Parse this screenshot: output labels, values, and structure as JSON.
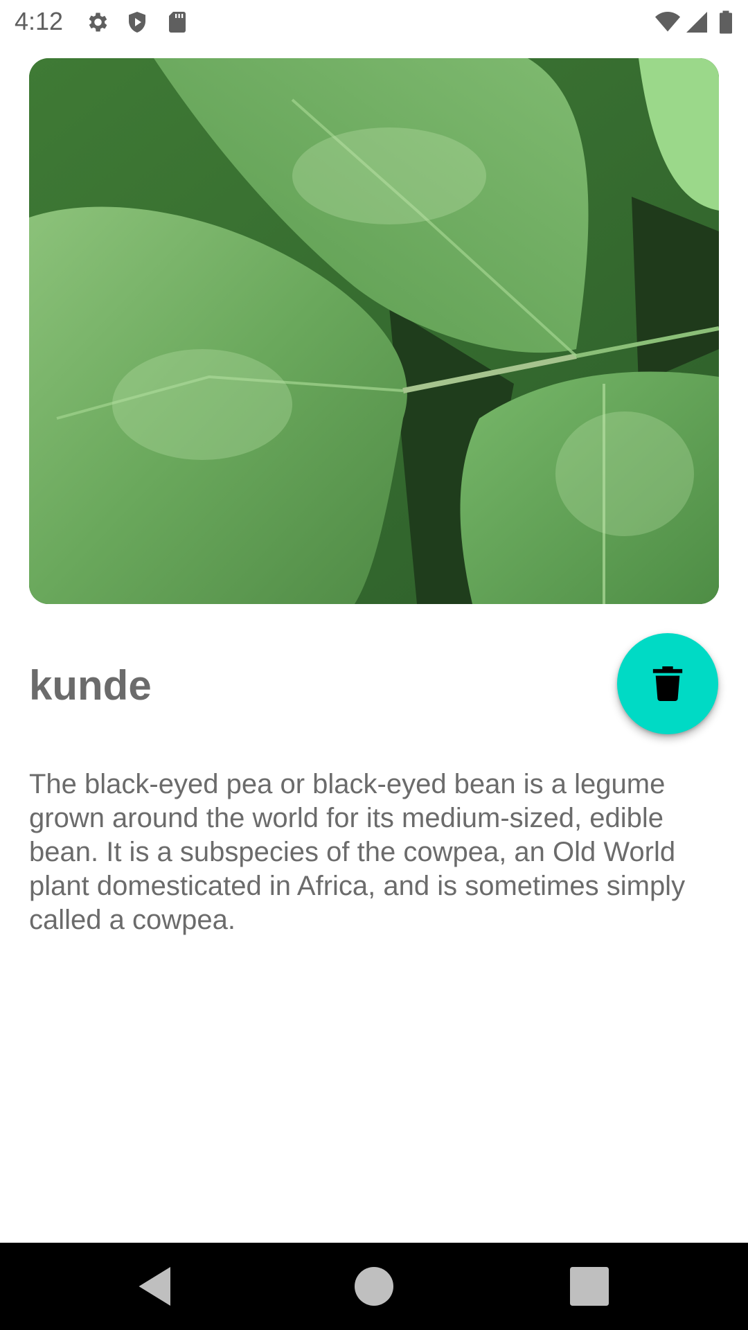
{
  "status_bar": {
    "time": "4:12",
    "left_icons": [
      "gear-icon",
      "shield-icon",
      "sd-card-icon"
    ],
    "right_icons": [
      "wifi-icon",
      "cell-signal-icon",
      "battery-icon"
    ]
  },
  "plant": {
    "image_icon": "plant-leaves-photo",
    "name": "kunde",
    "description": "The black-eyed pea or black-eyed bean is a legume grown around the world for its medium-sized, edible bean. It is a subspecies of the cowpea, an Old World plant domesticated in Africa, and is sometimes simply called a cowpea."
  },
  "fab": {
    "icon": "trash-icon",
    "color": "#00dac5"
  },
  "nav_bar": {
    "buttons": [
      "back-icon",
      "home-icon",
      "recents-icon"
    ]
  },
  "colors": {
    "text": "#6b6b6b",
    "accent": "#00dac5",
    "nav_background": "#000000"
  }
}
